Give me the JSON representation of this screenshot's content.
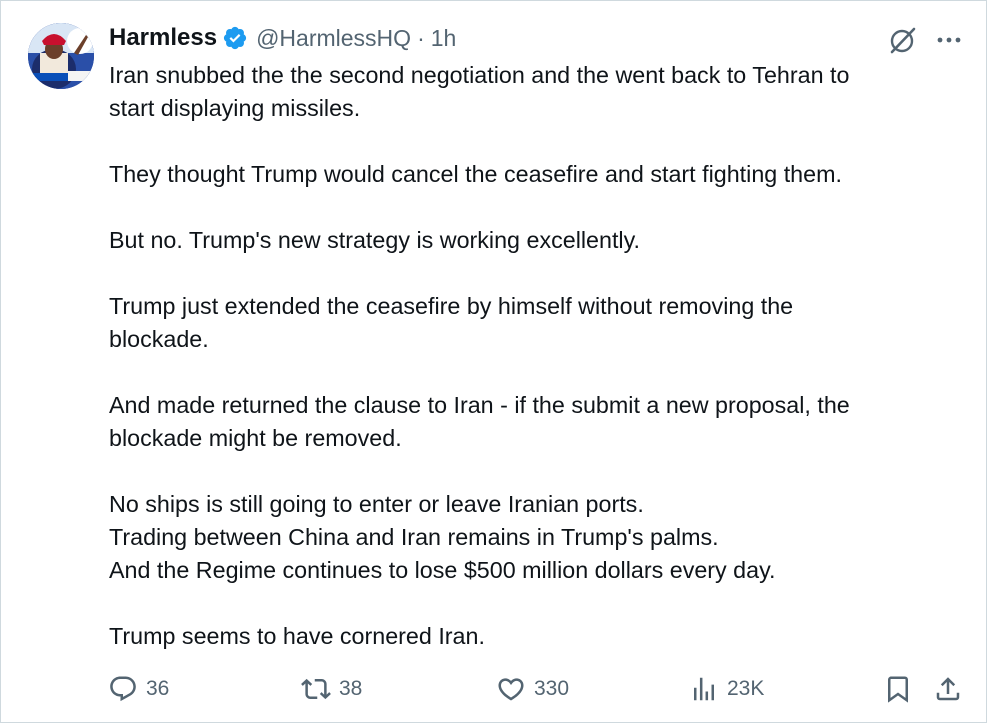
{
  "author": {
    "display_name": "Harmless",
    "handle": "@HarmlessHQ",
    "separator": "·",
    "timestamp": "1h",
    "verified": true,
    "verified_color": "#1d9bf0"
  },
  "tweet": {
    "paragraphs": [
      [
        "Iran snubbed the the second negotiation and the went back to Tehran to",
        "start displaying missiles."
      ],
      [
        "They thought Trump would cancel the ceasefire and start fighting them."
      ],
      [
        "But no. Trump's new strategy is working excellently."
      ],
      [
        "Trump just extended the ceasefire by himself without removing the",
        "blockade."
      ],
      [
        "And made returned the clause to Iran - if the submit a new proposal, the",
        "blockade might be removed."
      ],
      [
        "No ships is still going to enter or leave Iranian ports.",
        "Trading between China and Iran remains in Trump's palms.",
        "And the Regime continues to lose $500 million dollars every day."
      ],
      [
        "Trump seems to have cornered Iran."
      ]
    ]
  },
  "actions": {
    "replies": "36",
    "reposts": "38",
    "likes": "330",
    "views": "23K"
  },
  "icons": {
    "avatar": "avatar-image",
    "verified": "verified-badge-icon",
    "grok": "grok-icon",
    "more": "more-icon",
    "reply": "reply-icon",
    "repost": "repost-icon",
    "like": "like-icon",
    "views": "views-icon",
    "bookmark": "bookmark-icon",
    "share": "share-icon"
  },
  "colors": {
    "text": "#0f1419",
    "secondary": "#536471",
    "border": "#cfd9de"
  }
}
